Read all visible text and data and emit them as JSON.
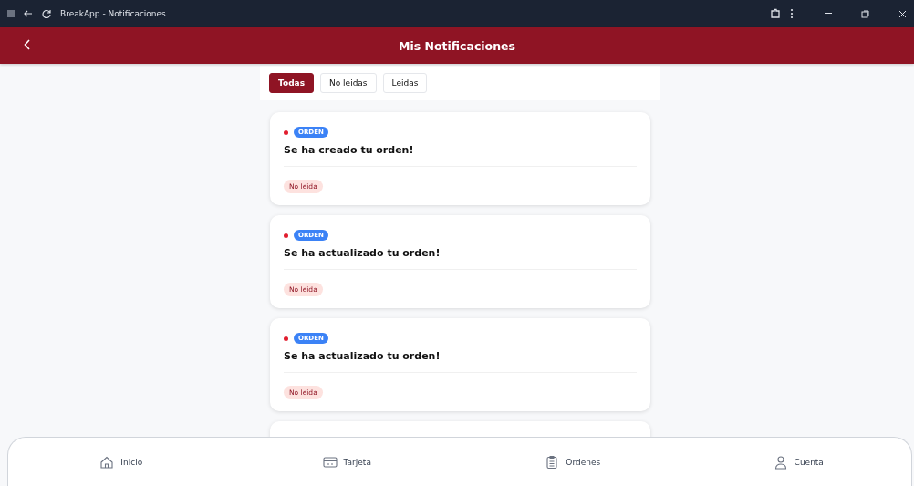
{
  "window": {
    "title": "BreakApp - Notificaciones"
  },
  "header": {
    "title": "Mis Notificaciones"
  },
  "filters": [
    {
      "label": "Todas",
      "selected": true
    },
    {
      "label": "No leidas",
      "selected": false
    },
    {
      "label": "Leidas",
      "selected": false
    }
  ],
  "notifications": [
    {
      "tag": "ORDEN",
      "title": "Se ha creado tu orden!",
      "status": "No leida",
      "read": false
    },
    {
      "tag": "ORDEN",
      "title": "Se ha actualizado tu orden!",
      "status": "No leida",
      "read": false
    },
    {
      "tag": "ORDEN",
      "title": "Se ha actualizado tu orden!",
      "status": "No leida",
      "read": false
    }
  ],
  "bottom_nav": [
    {
      "label": "Inicio"
    },
    {
      "label": "Tarjeta"
    },
    {
      "label": "Ordenes"
    },
    {
      "label": "Cuenta"
    }
  ]
}
